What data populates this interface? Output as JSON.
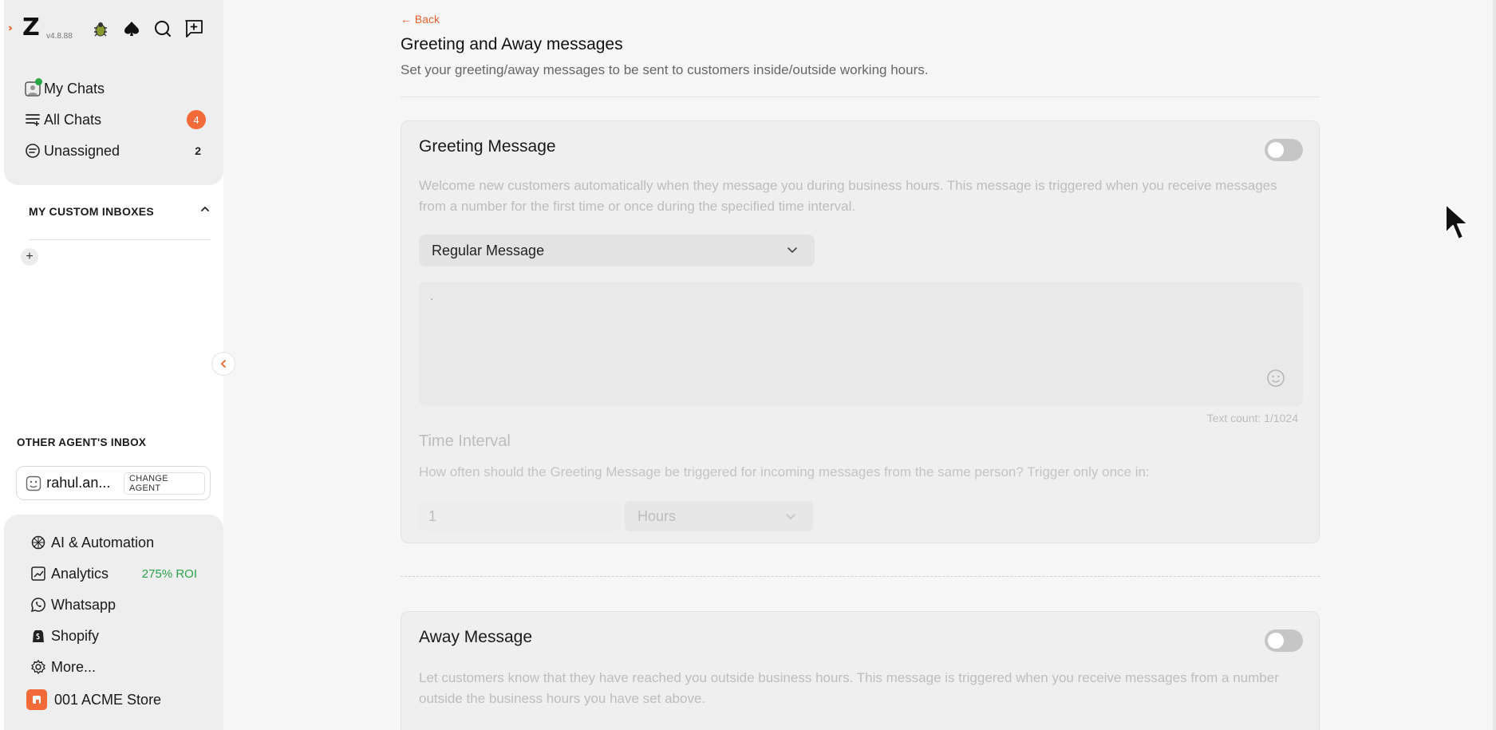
{
  "app": {
    "version": "v4.8.88",
    "accent_color": "#f26a37"
  },
  "sidebar": {
    "top_icons": [
      "bug-icon",
      "spade-icon",
      "search-icon",
      "new-chat-icon"
    ],
    "nav": [
      {
        "label": "My Chats",
        "icon": "my-chats-icon"
      },
      {
        "label": "All Chats",
        "icon": "all-chats-icon",
        "badge": "4"
      },
      {
        "label": "Unassigned",
        "icon": "unassigned-icon",
        "count": "2"
      }
    ],
    "custom_inboxes_heading": "MY CUSTOM INBOXES",
    "add_symbol": "+",
    "other_agents_heading": "OTHER AGENT'S INBOX",
    "agent_name": "rahul.an...",
    "change_agent_label": "CHANGE AGENT",
    "bottom_nav": [
      {
        "label": "AI & Automation",
        "icon": "ai-automation-icon"
      },
      {
        "label": "Analytics",
        "icon": "analytics-icon",
        "tag": "275% ROI"
      },
      {
        "label": "Whatsapp",
        "icon": "whatsapp-icon"
      },
      {
        "label": "Shopify",
        "icon": "shopify-icon"
      },
      {
        "label": "More...",
        "icon": "more-gear-icon"
      }
    ],
    "store_name": "001 ACME Store"
  },
  "page": {
    "back_label": "Back",
    "title": "Greeting and Away messages",
    "subtitle": "Set your greeting/away messages to be sent to customers inside/outside working hours."
  },
  "greeting": {
    "title": "Greeting Message",
    "enabled": false,
    "description": "Welcome new customers automatically when they message you during business hours. This message is triggered when you receive messages from a number for the first time or once during the specified time interval.",
    "message_type": "Regular Message",
    "message_text": ".",
    "text_count": "Text count: 1/1024",
    "time_interval_title": "Time Interval",
    "time_interval_desc": "How often should the Greeting Message be triggered for incoming messages from the same person? Trigger only once in:",
    "interval_value": "1",
    "interval_unit": "Hours"
  },
  "away": {
    "title": "Away Message",
    "enabled": false,
    "description": "Let customers know that they have reached you outside business hours. This message is triggered when you receive messages from a number outside the business hours you have set above."
  }
}
